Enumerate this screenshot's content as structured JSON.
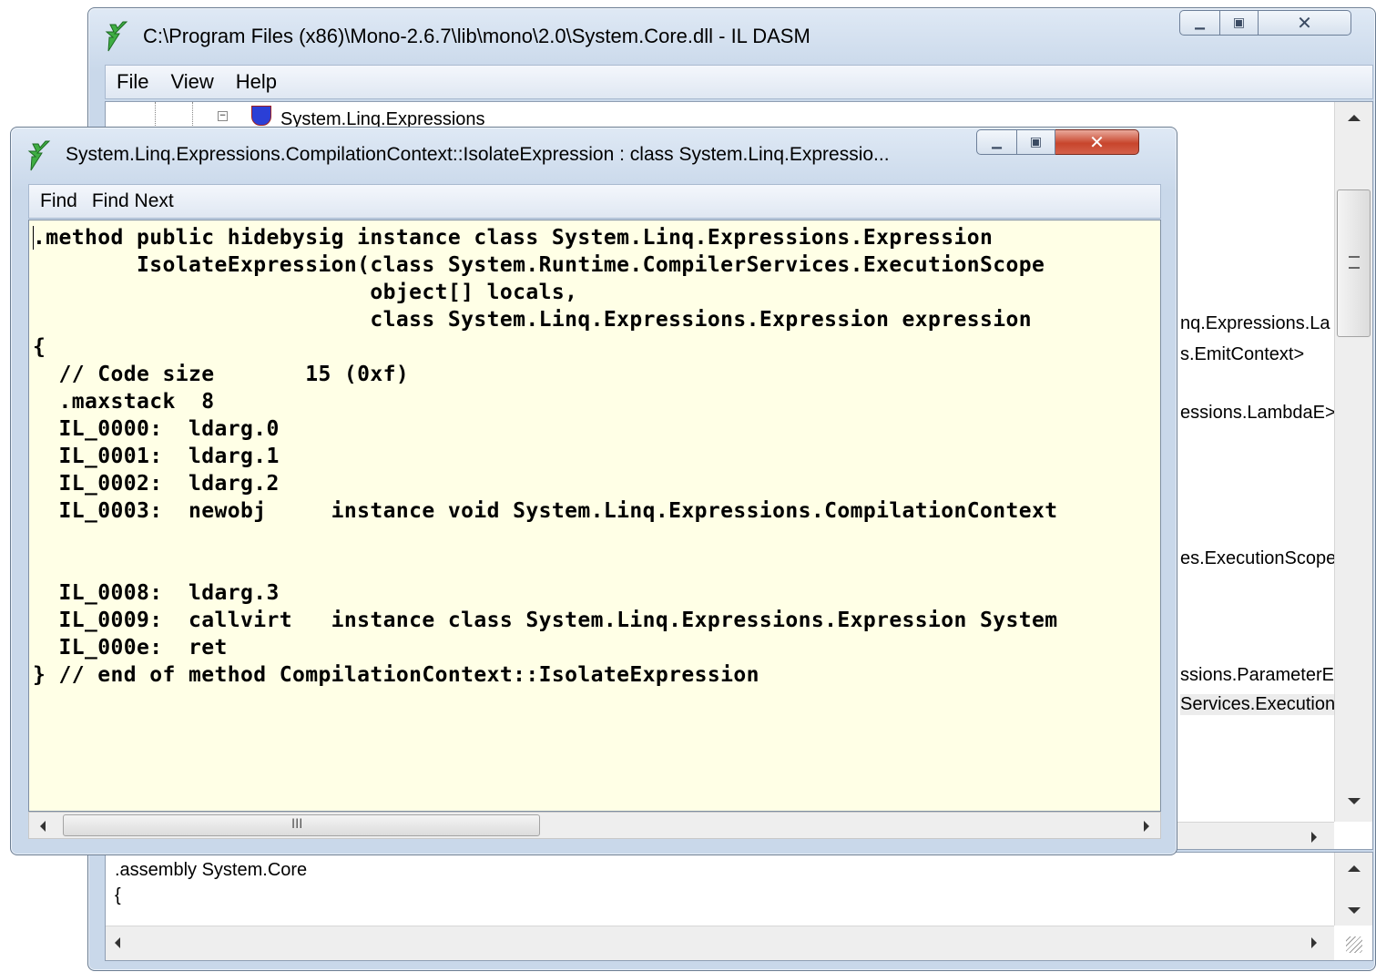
{
  "main_window": {
    "title": "C:\\Program Files (x86)\\Mono-2.6.7\\lib\\mono\\2.0\\System.Core.dll - IL DASM",
    "menu": [
      "File",
      "View",
      "Help"
    ],
    "tree_top_item": "System.Linq.Expressions",
    "tree_fragments": [
      "nq.Expressions.La",
      "s.EmitContext>",
      "essions.LambdaE>",
      "es.ExecutionScope",
      "ssions.ParameterE",
      "Services.Execution"
    ],
    "info_lines": [
      ".assembly System.Core",
      "{"
    ]
  },
  "method_window": {
    "title": "System.Linq.Expressions.CompilationContext::IsolateExpression : class System.Linq.Expressio...",
    "menu": [
      "Find",
      "Find Next"
    ],
    "code_lines": [
      ".method public hidebysig instance class System.Linq.Expressions.Expression",
      "        IsolateExpression(class System.Runtime.CompilerServices.ExecutionScope",
      "                          object[] locals,",
      "                          class System.Linq.Expressions.Expression expression",
      "{",
      "  // Code size       15 (0xf)",
      "  .maxstack  8",
      "  IL_0000:  ldarg.0",
      "  IL_0001:  ldarg.1",
      "  IL_0002:  ldarg.2",
      "  IL_0003:  newobj     instance void System.Linq.Expressions.CompilationContext",
      "",
      "",
      "  IL_0008:  ldarg.3",
      "  IL_0009:  callvirt   instance class System.Linq.Expressions.Expression System",
      "  IL_000e:  ret",
      "} // end of method CompilationContext::IsolateExpression"
    ],
    "scroll_thumb_label": "III"
  }
}
